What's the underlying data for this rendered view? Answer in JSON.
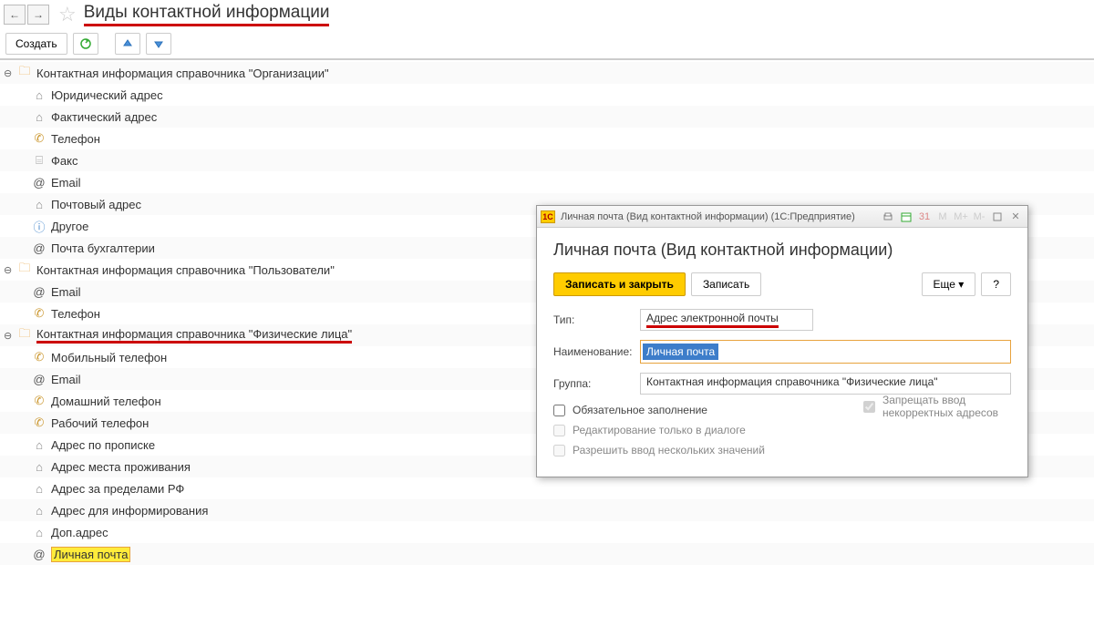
{
  "header": {
    "title": "Виды контактной информации"
  },
  "toolbar": {
    "create": "Создать"
  },
  "tree": {
    "groups": [
      {
        "label": "Контактная информация справочника \"Организации\"",
        "children": [
          {
            "icon": "house",
            "label": "Юридический адрес"
          },
          {
            "icon": "house",
            "label": "Фактический адрес"
          },
          {
            "icon": "phone",
            "label": "Телефон"
          },
          {
            "icon": "fax",
            "label": "Факс"
          },
          {
            "icon": "at",
            "label": "Email"
          },
          {
            "icon": "house",
            "label": "Почтовый адрес"
          },
          {
            "icon": "info",
            "label": "Другое"
          },
          {
            "icon": "at",
            "label": "Почта бухгалтерии"
          }
        ]
      },
      {
        "label": "Контактная информация справочника \"Пользователи\"",
        "children": [
          {
            "icon": "at",
            "label": "Email"
          },
          {
            "icon": "phone",
            "label": "Телефон"
          }
        ]
      },
      {
        "label": "Контактная информация справочника \"Физические лица\"",
        "underline": true,
        "children": [
          {
            "icon": "phone",
            "label": "Мобильный телефон"
          },
          {
            "icon": "at",
            "label": "Email"
          },
          {
            "icon": "phone",
            "label": "Домашний телефон"
          },
          {
            "icon": "phone",
            "label": "Рабочий телефон"
          },
          {
            "icon": "house",
            "label": "Адрес по прописке"
          },
          {
            "icon": "house",
            "label": "Адрес места проживания"
          },
          {
            "icon": "house",
            "label": "Адрес за пределами РФ"
          },
          {
            "icon": "house",
            "label": "Адрес для информирования"
          },
          {
            "icon": "house",
            "label": "Доп.адрес"
          },
          {
            "icon": "at",
            "label": "Личная почта",
            "highlight": true
          }
        ]
      }
    ]
  },
  "dialog": {
    "titlebar": "Личная почта (Вид контактной информации)  (1С:Предприятие)",
    "heading": "Личная почта (Вид контактной информации)",
    "buttons": {
      "save_close": "Записать и закрыть",
      "save": "Записать",
      "more": "Еще",
      "help": "?"
    },
    "fields": {
      "type_label": "Тип:",
      "type_value": "Адрес электронной почты",
      "name_label": "Наименование:",
      "name_value": "Личная почта",
      "group_label": "Группа:",
      "group_value": "Контактная информация справочника \"Физические лица\""
    },
    "checks": {
      "mandatory": "Обязательное заполнение",
      "forbid_incorrect": "Запрещать ввод некорректных адресов",
      "dialog_only": "Редактирование только в диалоге",
      "multiple": "Разрешить ввод нескольких значений"
    },
    "tb_icons": {
      "m": "M",
      "mp": "M+",
      "mm": "M-"
    }
  }
}
